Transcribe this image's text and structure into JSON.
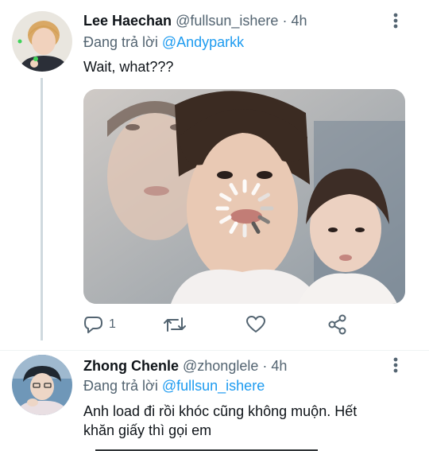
{
  "tweets": [
    {
      "author_name": "Lee Haechan",
      "handle": "@fullsun_ishere",
      "separator": "·",
      "time": "4h",
      "replying_prefix": "Đang trả lời",
      "replying_to": "@Andyparkk",
      "text": "Wait, what???",
      "reply_count": "1",
      "icons": [
        "reply-icon",
        "retweet-icon",
        "like-icon",
        "share-icon",
        "more-icon",
        "loading-spinner-icon"
      ]
    },
    {
      "author_name": "Zhong Chenle",
      "handle": "@zhonglele",
      "separator": "·",
      "time": "4h",
      "replying_prefix": "Đang trả lời",
      "replying_to": "@fullsun_ishere",
      "text": "Anh load đi rồi khóc cũng không muộn. Hết khăn giấy thì gọi em",
      "icons": [
        "more-icon"
      ]
    }
  ],
  "colors": {
    "link": "#1d9bf0",
    "secondary_text": "#536471",
    "thread_line": "#cfd9de"
  }
}
